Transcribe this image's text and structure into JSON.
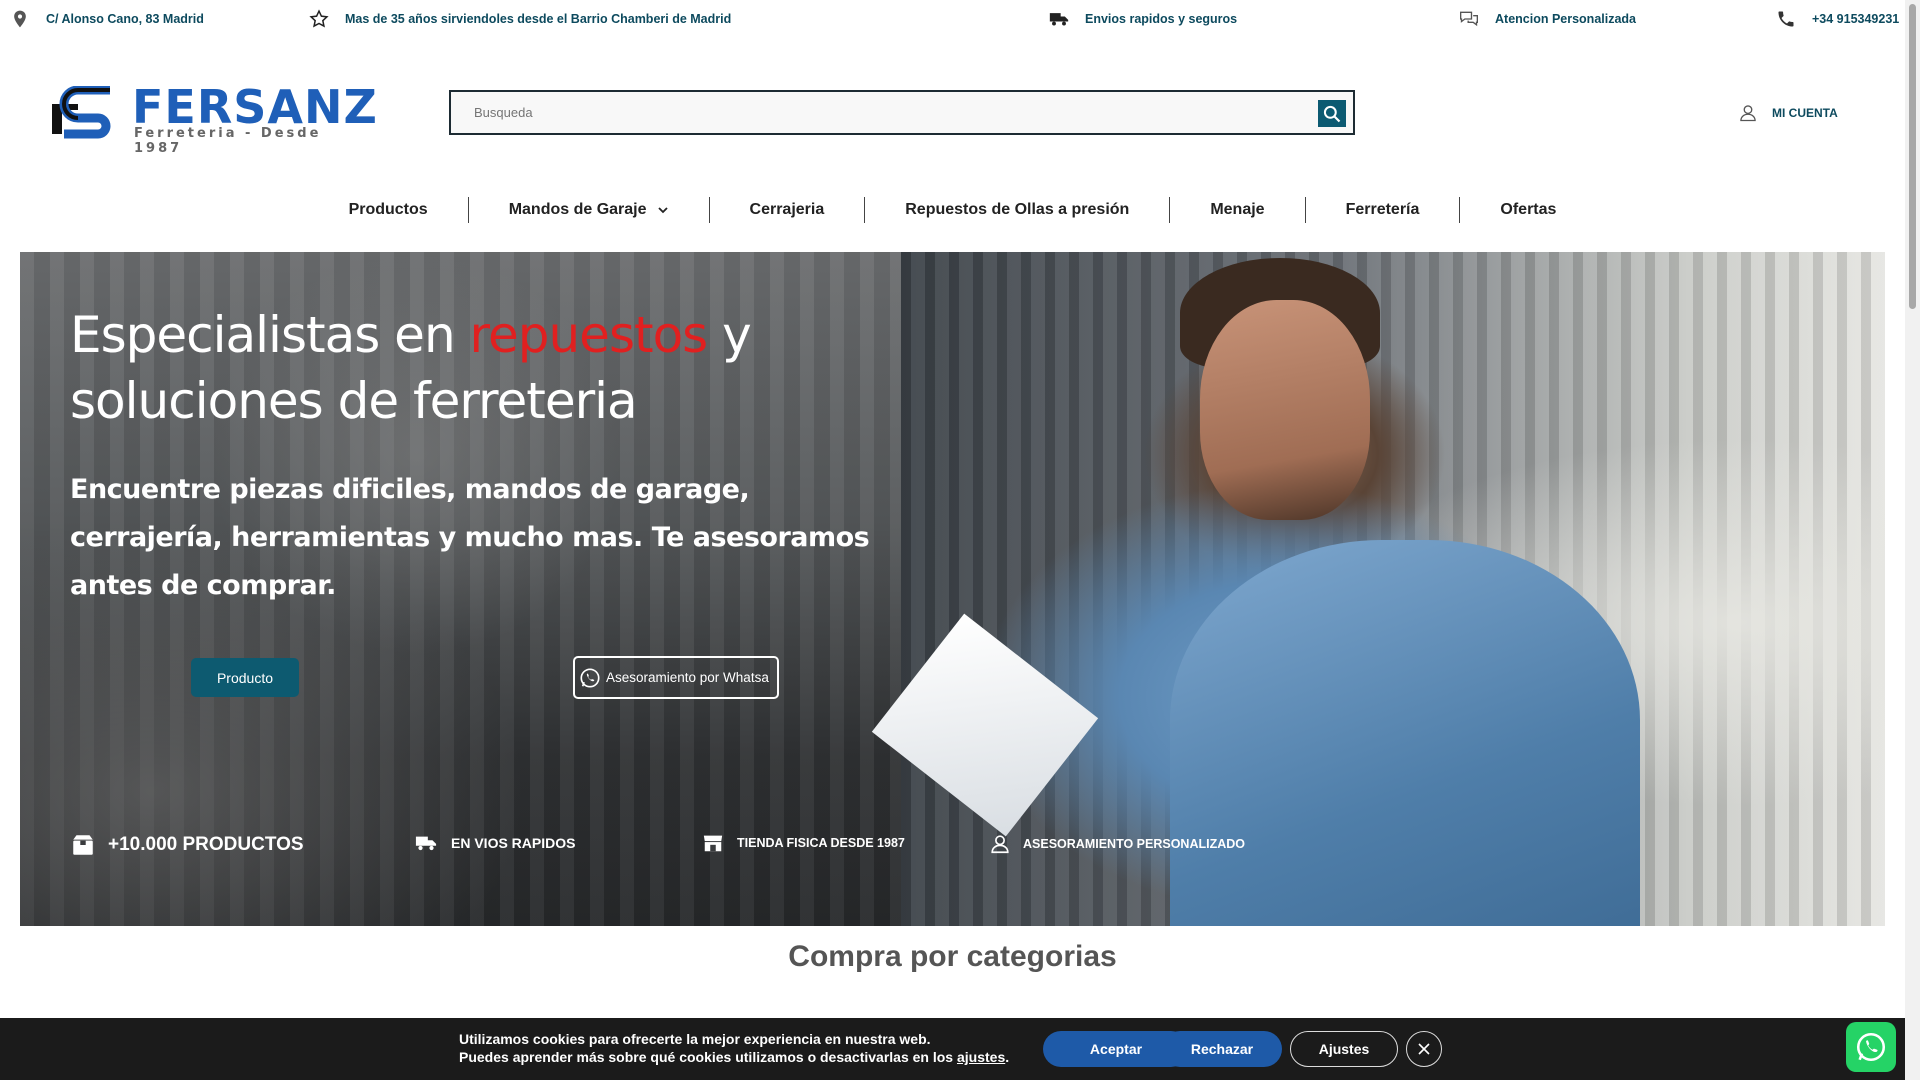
{
  "topbar": {
    "address": "C/ Alonso Cano, 83 Madrid",
    "years": "Mas de 35 años sirviendoles desde el Barrio Chamberi de Madrid",
    "shipping": "Envios rapidos y seguros",
    "attention": "Atencion Personalizada",
    "phone": "+34 915349231"
  },
  "header": {
    "logo_text": "FERSANZ",
    "logo_tagline": "Ferreteria - Desde 1987",
    "search_placeholder": "Busqueda",
    "account_label": "MI CUENTA"
  },
  "nav": {
    "items": [
      "Productos",
      "Mandos de Garaje",
      "Cerrajeria",
      "Repuestos de Ollas a presión",
      "Menaje",
      "Ferretería",
      "Ofertas"
    ]
  },
  "hero": {
    "title_pre": "Especialistas en ",
    "title_highlight": "repuestos",
    "title_post": " y soluciones de ferreteria",
    "subtitle": "Encuentre piezas dificiles, mandos de garage, cerrajería, herramientas y mucho mas. Te asesoramos antes de comprar.",
    "btn_product": "Producto",
    "btn_whatsapp": "Asesoramiento por Whatsa",
    "features": [
      "+10.000 PRODUCTOS",
      "EN VIOS RAPIDOS",
      "TIENDA FISICA DESDE 1987",
      "ASESORAMIENTO PERSONALIZADO"
    ]
  },
  "categories": {
    "title": "Compra por categorias"
  },
  "cookie": {
    "line1": "Utilizamos cookies para ofrecerte la mejor experiencia en nuestra web.",
    "line2_pre": "Puedes aprender más sobre qué cookies utilizamos o desactivarlas en los ",
    "line2_link": "ajustes",
    "line2_post": ".",
    "accept": "Aceptar",
    "reject": "Rechazar",
    "settings": "Ajustes"
  },
  "colors": {
    "brand_teal": "#0d4a5e",
    "accent_red": "#e02020",
    "cookie_blue": "#1e5aa8",
    "whatsapp_green": "#25d366"
  }
}
